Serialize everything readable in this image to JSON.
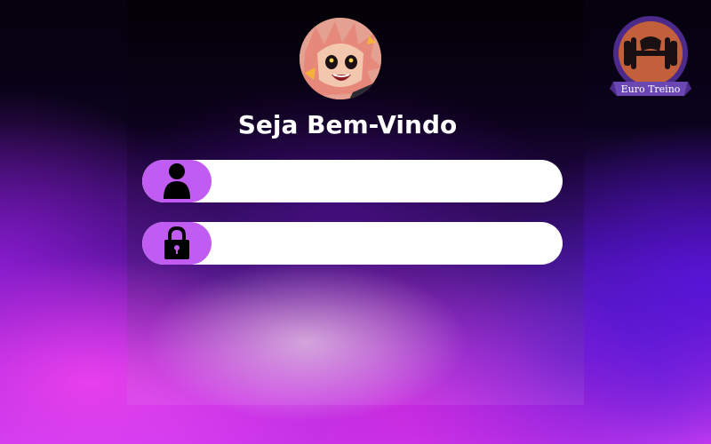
{
  "welcome": {
    "title": "Seja Bem-Vindo"
  },
  "avatar": {
    "alt": "user-avatar"
  },
  "form": {
    "username": {
      "value": "",
      "placeholder": "",
      "icon": "user-icon"
    },
    "password": {
      "value": "",
      "placeholder": "",
      "icon": "lock-icon"
    }
  },
  "logo": {
    "text": "Euro Treino"
  },
  "colors": {
    "accent": "#c05cf2",
    "field_bg": "#ffffff",
    "title": "#ffffff",
    "logo_circle": "#c2603c",
    "logo_ring": "#4b2a8a",
    "logo_ribbon": "#6a47b3"
  }
}
